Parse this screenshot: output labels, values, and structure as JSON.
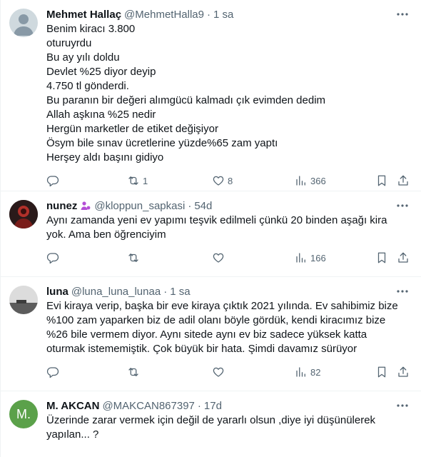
{
  "tweets": [
    {
      "name": "Mehmet Hallaç",
      "handle": "@MehmetHalla9",
      "time": "1 sa",
      "text": "Benim kiracı 3.800\noturuyrdu\nBu ay yılı doldu\nDevlet %25 diyor deyip\n4.750 tl gönderdi.\nBu paranın bir değeri alımgücü kalmadı çık evimden dedim\nAllah aşkına %25 nedir\nHergün marketler de etiket değişiyor\nÖsym bile sınav ücretlerine yüzde%65 zam yaptı\nHerşey aldı başını gidiyo",
      "replies": "",
      "retweets": "1",
      "likes": "8",
      "views": "366"
    },
    {
      "name": "nunez",
      "handle": "@kloppun_sapkasi",
      "time": "54d",
      "text": "Aynı zamanda yeni ev yapımı teşvik edilmeli çünkü 20 binden aşağı kira\nyok. Ama ben öğrenciyim",
      "replies": "",
      "retweets": "",
      "likes": "",
      "views": "166"
    },
    {
      "name": "luna",
      "handle": "@luna_luna_lunaa",
      "time": "1 sa",
      "text": "Evi kiraya verip, başka bir eve kiraya çıktık 2021 yılında. Ev sahibimiz bize\n%100 zam yaparken biz de adil olanı böyle gördük, kendi kiracımız bize\n%26 bile vermem diyor. Aynı sitede aynı ev biz sadece yüksek katta\noturmak istememiştik. Çok büyük bir hata. Şimdi davamız sürüyor",
      "replies": "",
      "retweets": "",
      "likes": "",
      "views": "82"
    },
    {
      "name": "M. AKCAN",
      "handle": "@MAKCAN867397",
      "time": "17d",
      "avatar_letter": "M.",
      "text": "Üzerinde zarar vermek için değil de yararlı olsun ,diye iyi düşünülerek\nyapılan... ?"
    }
  ],
  "icons": {
    "reply": "reply-icon",
    "retweet": "retweet-icon",
    "like": "heart-icon",
    "views": "views-icon",
    "bookmark": "bookmark-icon",
    "share": "share-icon",
    "more": "more-icon"
  },
  "colors": {
    "text": "#0f1419",
    "secondary": "#536471",
    "divider": "#eff3f4",
    "badge": "#b44fd6",
    "avatar_letter_bg": "#5ba14a"
  }
}
